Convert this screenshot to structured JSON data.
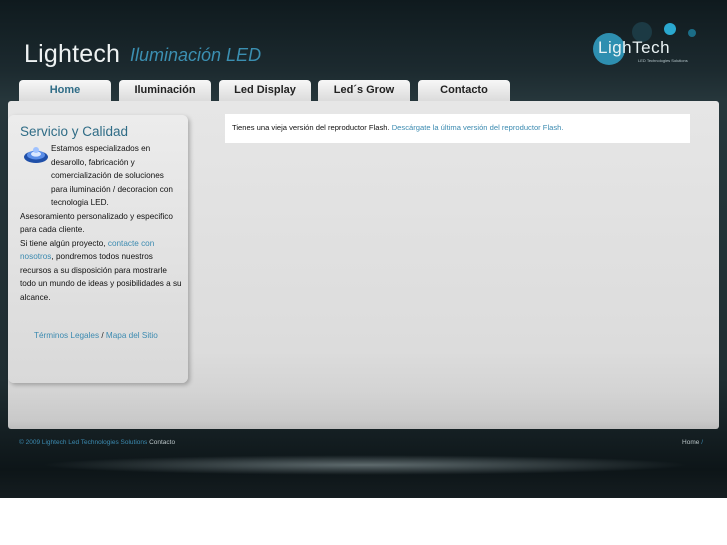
{
  "header": {
    "brand": "Lightech",
    "tagline": "Iluminación LED",
    "logo": {
      "text": "LighTech",
      "sub": "LED Technologies Solutions"
    }
  },
  "nav": {
    "tabs": [
      {
        "label": "Home",
        "active": true
      },
      {
        "label": "Iluminación",
        "active": false
      },
      {
        "label": "Led Display",
        "active": false
      },
      {
        "label": "Led´s Grow",
        "active": false
      },
      {
        "label": "Contacto",
        "active": false
      }
    ]
  },
  "sidebar": {
    "title": "Servicio y Calidad",
    "icon": "led-lamp-icon",
    "text1": "Estamos especializados en desarollo, fabricación y comercialización de soluciones para iluminación / decoracion con tecnologia LED.",
    "text2": "Asesoramiento personalizado y especifico para cada cliente.",
    "text3_pre": "Si tiene algún proyecto, ",
    "text3_link": "contacte con nosotros",
    "text3_post": ", pondremos todos nuestros recursos a su disposición para mostrarle todo un mundo de ideas y posibilidades a su alcance.",
    "legal_link": "Términos Legales",
    "separator": "/",
    "sitemap_link": "Mapa del Sitio"
  },
  "main": {
    "flash_text": "Tienes una vieja versión del reproductor Flash. ",
    "flash_link": "Descárgate la última versión del reproductor Flash."
  },
  "footer": {
    "copyright": "© 2009 Lightech Led Technologies Solutions",
    "contact": "Contacto",
    "home": "Home",
    "slash": "/"
  },
  "colors": {
    "accent": "#3b8ab0",
    "background_dark": "#1f2d31",
    "panel": "#dcdcdc"
  }
}
